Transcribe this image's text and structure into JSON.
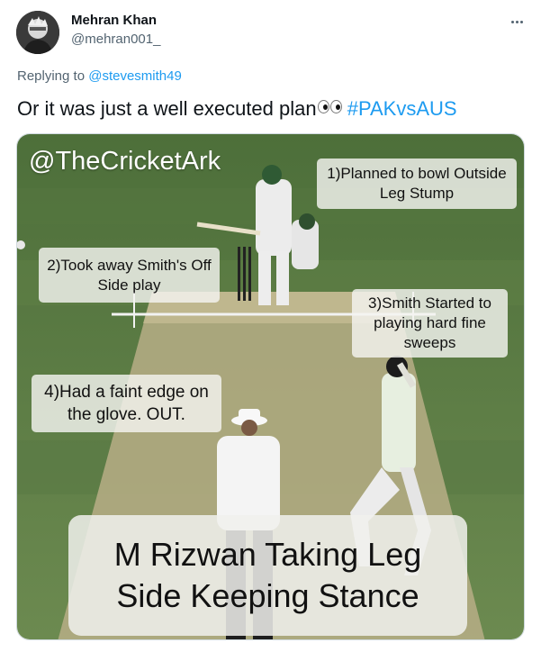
{
  "tweet": {
    "author_name": "Mehran Khan",
    "author_handle": "@mehran001_",
    "avatar_icon": "user-avatar-icon",
    "more_icon": "more-options-icon",
    "replying_prefix": "Replying to",
    "replying_handle": "@stevesmith49",
    "text": "Or it was just a well executed plan",
    "emoji": "eyes-emoji",
    "hashtag": "#PAKvsAUS"
  },
  "media": {
    "watermark": "@TheCricketArk",
    "notes": [
      "1)Planned to bowl Outside Leg Stump",
      "2)Took away Smith's Off Side play",
      "3)Smith Started to playing hard fine sweeps",
      "4)Had a faint edge on the glove. OUT."
    ],
    "caption": "M Rizwan Taking Leg Side Keeping Stance"
  },
  "colors": {
    "link": "#1d9bf0",
    "secondary_text": "#536471",
    "pitch_green": "#5b7a45"
  }
}
